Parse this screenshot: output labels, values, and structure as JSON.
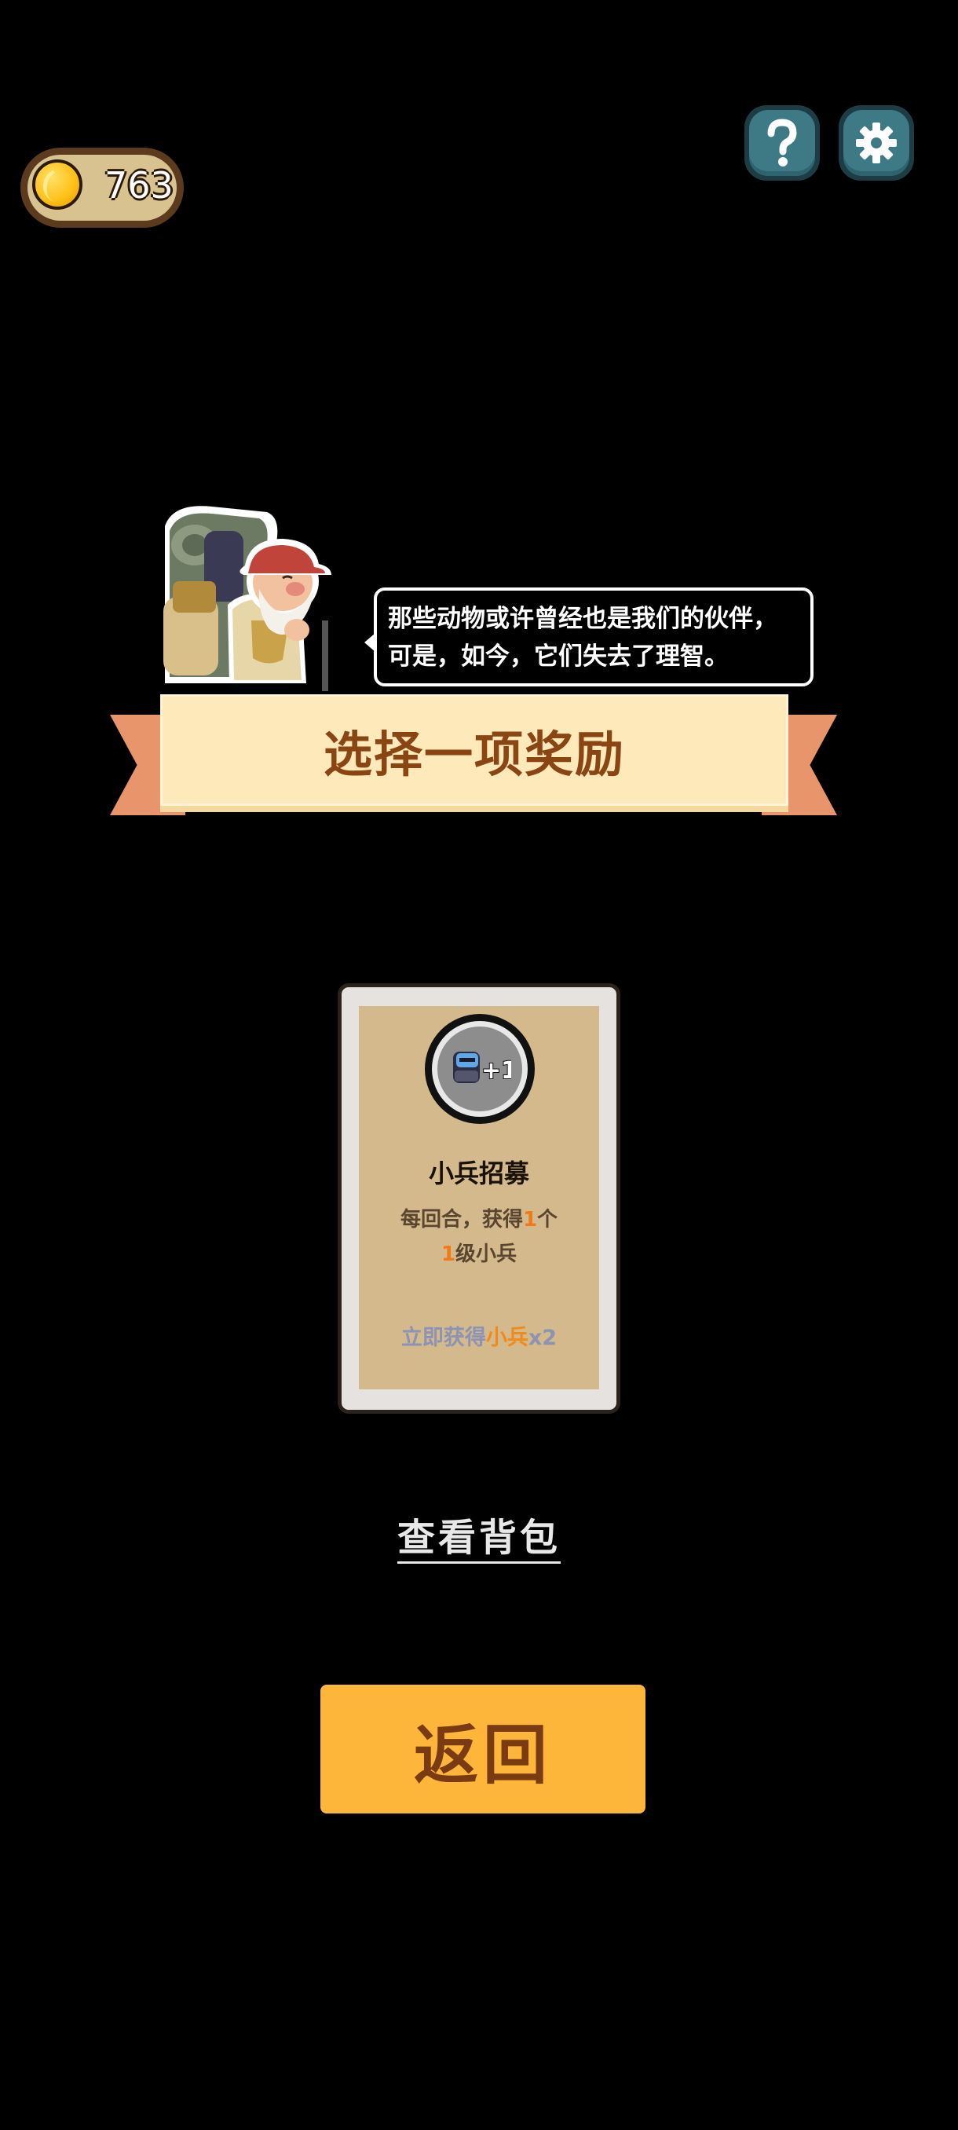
{
  "hud": {
    "coins": "763",
    "coin_icon": "gold-coin-icon",
    "help_icon": "question-mark-icon",
    "settings_icon": "gear-icon"
  },
  "dialog": {
    "line1": "那些动物或许曾经也是我们的伙伴，",
    "line2": "可是，如今，它们失去了理智。"
  },
  "banner": {
    "title": "选择一项奖励"
  },
  "reward_card": {
    "icon": "soldier-plus-one-icon",
    "icon_text": "+1",
    "name": "小兵招募",
    "desc_part1": "每回合，获得",
    "desc_num1": "1",
    "desc_part2": "个",
    "desc_num2": "1",
    "desc_part3": "级小兵",
    "bonus_prefix": "立即获得",
    "bonus_item": "小兵",
    "bonus_suffix": "x2"
  },
  "actions": {
    "view_backpack": "查看背包",
    "return": "返回"
  },
  "colors": {
    "background": "#000000",
    "banner": "#fde9b9",
    "banner_text": "#8b4513",
    "return_button": "#fdb63a",
    "highlight": "#f07a1a",
    "icon_button": "#3e7a86"
  }
}
